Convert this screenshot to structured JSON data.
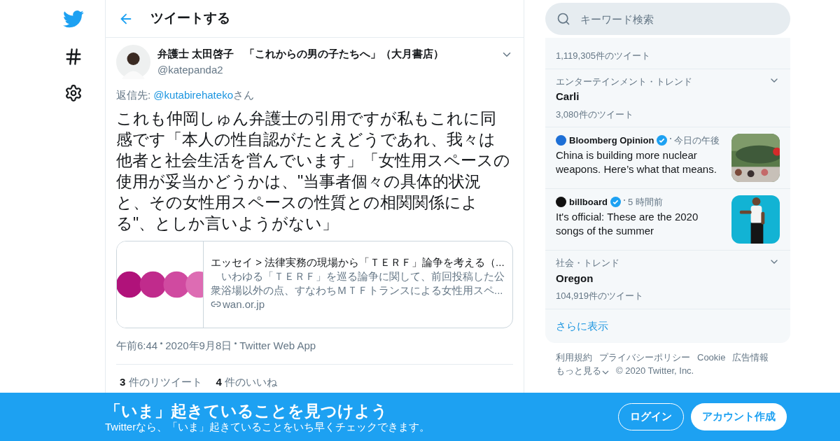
{
  "header": {
    "title": "ツイートする"
  },
  "tweet": {
    "name": "弁護士 太田啓子　「これからの男の子たちへ」（大月書店）",
    "handle": "@katepanda2",
    "reply_label": "返信先:",
    "reply_to": "@kutabirehateko",
    "reply_suffix": "さん",
    "text": "これも仲岡しゅん弁護士の引用ですが私もこれに同感です「本人の性自認がたとえどうであれ、我々は他者と社会生活を営んでいます」「女性用スペースの使用が妥当かどうかは、\"当事者個々の具体的状況と、その女性用スペースの性質との相関関係による\"、としか言いようがない」",
    "card": {
      "title": "エッセイ > 法律実務の現場から「ＴＥＲＦ」論争を考える（...",
      "description": "　いわゆる「ＴＥＲＦ」を巡る論争に関して、前回投稿した公衆浴場以外の点、すなわちＭＴＦトランスによる女性用スペ...",
      "domain": "wan.or.jp"
    },
    "meta": [
      "午前6:44",
      "2020年9月8日",
      "Twitter Web App"
    ],
    "stats": [
      {
        "count": "3",
        "label": "件のリツイート"
      },
      {
        "count": "4",
        "label": "件のいいね"
      }
    ]
  },
  "search": {
    "placeholder": "キーワード検索"
  },
  "trends": [
    {
      "kind": "trend",
      "count": "1,119,305件のツイート"
    },
    {
      "kind": "trend",
      "category": "エンターテインメント・トレンド",
      "name": "Carli",
      "count": "3,080件のツイート"
    },
    {
      "kind": "news",
      "source": "Bloomberg Opinion",
      "time": "今日の午後",
      "headline": "China is building more nuclear weapons. Here’s what that means.",
      "color": "#1d6fd6"
    },
    {
      "kind": "news",
      "source": "billboard",
      "time": "5 時間前",
      "headline": "It's official: These are the 2020 songs of the summer",
      "color": "#111111"
    },
    {
      "kind": "trend",
      "category": "社会・トレンド",
      "name": "Oregon",
      "count": "104,919件のツイート"
    }
  ],
  "show_more": "さらに表示",
  "footer": {
    "links": [
      "利用規約",
      "プライバシーポリシー",
      "Cookie",
      "広告情報",
      "もっと見る"
    ],
    "copyright": "© 2020 Twitter, Inc."
  },
  "banner": {
    "title": "「いま」起きていることを見つけよう",
    "subtitle": "Twitterなら、「いま」起きていることをいち早くチェックできます。",
    "login": "ログイン",
    "signup": "アカウント作成"
  }
}
